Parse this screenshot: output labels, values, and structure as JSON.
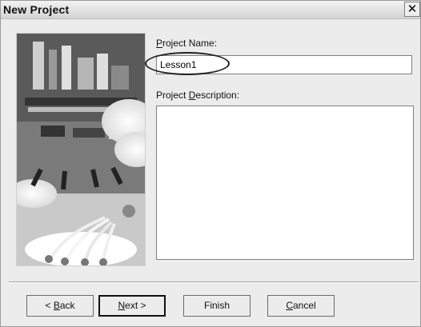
{
  "window": {
    "title": "New Project",
    "close_glyph": "✕"
  },
  "form": {
    "name_label_accel": "P",
    "name_label_rest": "roject Name:",
    "name_value": "Lesson1",
    "desc_label_pre": "Project ",
    "desc_label_accel": "D",
    "desc_label_rest": "escription:",
    "desc_value": ""
  },
  "buttons": {
    "back_pre": "< ",
    "back_accel": "B",
    "back_rest": "ack",
    "next_accel": "N",
    "next_rest": "ext >",
    "finish": "Finish",
    "cancel_accel": "C",
    "cancel_rest": "ancel"
  }
}
